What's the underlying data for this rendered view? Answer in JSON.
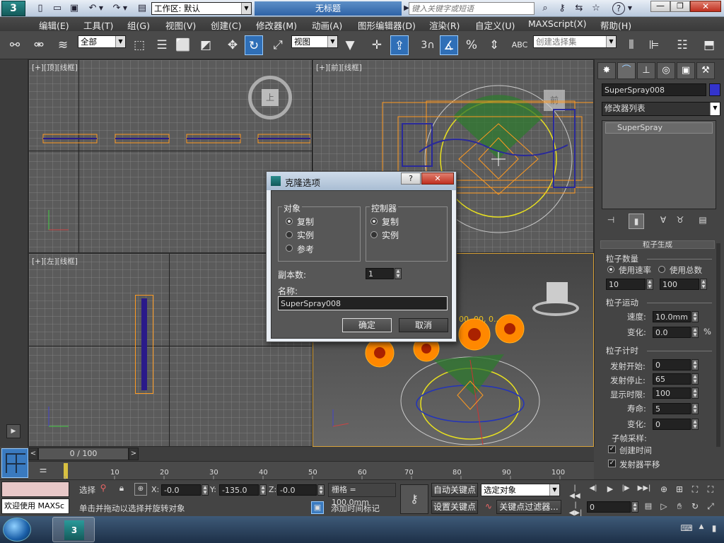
{
  "titlebar": {
    "workspace_label": "工作区: 默认",
    "doc_title": "无标题",
    "search_placeholder": "键入关键字或短语"
  },
  "menu": [
    "编辑(E)",
    "工具(T)",
    "组(G)",
    "视图(V)",
    "创建(C)",
    "修改器(M)",
    "动画(A)",
    "图形编辑器(D)",
    "渲染(R)",
    "自定义(U)",
    "MAXScript(X)",
    "帮助(H)"
  ],
  "toolbar": {
    "filter": "全部",
    "ref_coord": "视图",
    "snap_num": "3",
    "named_selection": "创建选择集"
  },
  "viewports": {
    "top": "[+][顶][线框]",
    "front": "[+][前][线框]",
    "left": "[+][左][线框]",
    "persp_label": "00, 00, 0..."
  },
  "viewcube": {
    "top": "上",
    "front": "前"
  },
  "command_panel": {
    "object_name": "SuperSpray008",
    "object_color": "#3333cc",
    "modifier_list": "修改器列表",
    "stack_item": "SuperSpray",
    "rollout_title": "粒子生成",
    "particle_quantity": {
      "title": "粒子数量",
      "use_rate": "使用速率",
      "use_total": "使用总数",
      "rate_value": "10",
      "total_value": "100"
    },
    "particle_motion": {
      "title": "粒子运动",
      "speed_label": "速度:",
      "speed_value": "10.0mm",
      "variation_label": "变化:",
      "variation_value": "0.0",
      "percent": "%"
    },
    "particle_timing": {
      "title": "粒子计时",
      "emit_start_label": "发射开始:",
      "emit_start": "0",
      "emit_stop_label": "发射停止:",
      "emit_stop": "65",
      "display_until_label": "显示时限:",
      "display_until": "100",
      "life_label": "寿命:",
      "life": "5",
      "variation_label": "变化:",
      "variation": "0",
      "subframe_label": "子帧采样:",
      "creation_time": "创建时间",
      "emitter_translation": "发射器平移"
    }
  },
  "dialog": {
    "title": "克隆选项",
    "object_group": "对象",
    "object_options": [
      "复制",
      "实例",
      "参考"
    ],
    "controller_group": "控制器",
    "controller_options": [
      "复制",
      "实例"
    ],
    "copies_label": "副本数:",
    "copies_value": "1",
    "name_label": "名称:",
    "name_value": "SuperSpray008",
    "ok": "确定",
    "cancel": "取消"
  },
  "timeline": {
    "frame_display": "0 / 100",
    "ticks": [
      "10",
      "20",
      "30",
      "40",
      "50",
      "60",
      "70",
      "80",
      "90",
      "100"
    ]
  },
  "status": {
    "welcome": "欢迎使用 MAXSc",
    "select_label": "选择",
    "x_label": "X:",
    "x_value": "-0.0",
    "y_label": "Y:",
    "y_value": "-135.0",
    "z_label": "Z:",
    "z_value": "-0.0",
    "grid": "栅格 = 100.0mm",
    "prompt": "单击并拖动以选择并旋转对象",
    "add_time_tag": "添加时间标记",
    "auto_key": "自动关键点",
    "set_key": "设置关键点",
    "key_mode": "选定对象",
    "key_filters": "关键点过滤器...",
    "frame_field": "0"
  }
}
